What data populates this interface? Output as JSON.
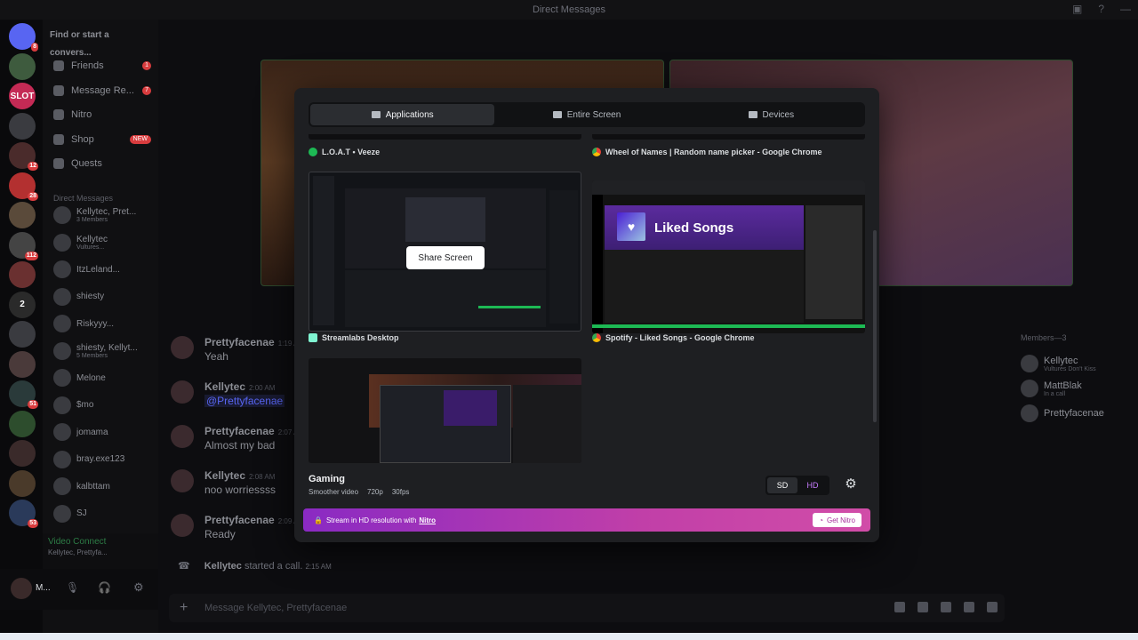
{
  "window": {
    "title": "Direct Messages"
  },
  "servers": [
    {
      "label": "",
      "color": "#5865f2",
      "badge": "8"
    },
    {
      "label": "",
      "color": "#3e5b3e",
      "badge": ""
    },
    {
      "label": "SLOT",
      "color": "#c42a55",
      "badge": ""
    },
    {
      "label": "",
      "color": "#3a3b40",
      "badge": ""
    },
    {
      "label": "",
      "color": "#4a2b2b",
      "badge": "12"
    },
    {
      "label": "",
      "color": "#b33030",
      "badge": "28"
    },
    {
      "label": "",
      "color": "#5a4a3a",
      "badge": ""
    },
    {
      "label": "",
      "color": "#444",
      "badge": "112"
    },
    {
      "label": "",
      "color": "#6a3030",
      "badge": ""
    },
    {
      "label": "2",
      "color": "#2a2a2a",
      "badge": ""
    },
    {
      "label": "",
      "color": "#3a3b40",
      "badge": ""
    },
    {
      "label": "",
      "color": "#4a3a3a",
      "badge": ""
    },
    {
      "label": "",
      "color": "#2a3a3a",
      "badge": "51"
    },
    {
      "label": "",
      "color": "#2d4d2d",
      "badge": ""
    },
    {
      "label": "",
      "color": "#3a2a2a",
      "badge": ""
    },
    {
      "label": "",
      "color": "#4a3a2a",
      "badge": ""
    },
    {
      "label": "",
      "color": "#2a3a5a",
      "badge": "53"
    }
  ],
  "sidebar": {
    "search_placeholder": "Find or start a convers...",
    "nav": [
      {
        "label": "Friends",
        "count": "1",
        "tag": ""
      },
      {
        "label": "Message Re...",
        "count": "7",
        "tag": ""
      },
      {
        "label": "Nitro",
        "count": "",
        "tag": ""
      },
      {
        "label": "Shop",
        "count": "",
        "tag": "NEW"
      },
      {
        "label": "Quests",
        "count": "",
        "tag": ""
      }
    ],
    "dm_header": "Direct Messages",
    "dms": [
      {
        "name": "Kellytec, Pret...",
        "sub": "3 Members"
      },
      {
        "name": "Kellytec",
        "sub": "Vultures..."
      },
      {
        "name": "ItzLeland...",
        "sub": ""
      },
      {
        "name": "shiesty",
        "sub": ""
      },
      {
        "name": "Riskyyy...",
        "sub": ""
      },
      {
        "name": "shiesty, Kellyt...",
        "sub": "5 Members"
      },
      {
        "name": "Melone",
        "sub": ""
      },
      {
        "name": "$mo",
        "sub": ""
      },
      {
        "name": "jomama",
        "sub": ""
      },
      {
        "name": "bray.exe123",
        "sub": ""
      },
      {
        "name": "kalbttam",
        "sub": ""
      },
      {
        "name": "SJ",
        "sub": ""
      }
    ],
    "voice": {
      "title": "Video Connect",
      "sub": "Kellytec, Prettyfa..."
    },
    "user": {
      "name": "M..."
    }
  },
  "chat": {
    "messages": [
      {
        "author": "Prettyfacenae",
        "time": "1:19 AM",
        "text": "Yeah",
        "mention": ""
      },
      {
        "author": "Kellytec",
        "time": "2:00 AM",
        "text": "",
        "mention": "@Prettyfacenae"
      },
      {
        "author": "Prettyfacenae",
        "time": "2:07 AM",
        "text": "Almost my bad",
        "mention": ""
      },
      {
        "author": "Kellytec",
        "time": "2:08 AM",
        "text": "noo worriessss",
        "mention": ""
      },
      {
        "author": "Prettyfacenae",
        "time": "2:09 AM",
        "text": "Ready",
        "mention": ""
      }
    ],
    "call": {
      "who": "Kellytec",
      "text": "started a call.",
      "time": "2:15 AM"
    },
    "composer_placeholder": "Message Kellytec, Prettyfacenae"
  },
  "members": {
    "header": "Members—3",
    "list": [
      {
        "name": "Kellytec",
        "sub": "Vultures Don't Kiss"
      },
      {
        "name": "MattBlak",
        "sub": "In a call"
      },
      {
        "name": "Prettyfacenae",
        "sub": ""
      }
    ]
  },
  "modal": {
    "tabs": [
      {
        "label": "Applications",
        "active": true
      },
      {
        "label": "Entire Screen",
        "active": false
      },
      {
        "label": "Devices",
        "active": false
      }
    ],
    "sources": [
      {
        "label": "L.O.A.T • Veeze",
        "icon_color": "#1db954"
      },
      {
        "label": "Wheel of Names | Random name picker - Google Chrome",
        "icon_color": "#f4b400"
      },
      {
        "label": "Streamlabs Desktop",
        "icon_color": "#80f5d2"
      },
      {
        "label": "Spotify - Liked Songs - Google Chrome",
        "icon_color": "#f4b400"
      }
    ],
    "share_button": "Share Screen",
    "liked_songs_title": "Liked Songs",
    "quality": {
      "title": "Gaming",
      "sub": [
        "Smoother video",
        "720p",
        "30fps"
      ],
      "sd": "SD",
      "hd": "HD"
    },
    "nitro": {
      "text": "Stream in HD resolution with",
      "link": "Nitro",
      "button": "Get Nitro"
    }
  }
}
